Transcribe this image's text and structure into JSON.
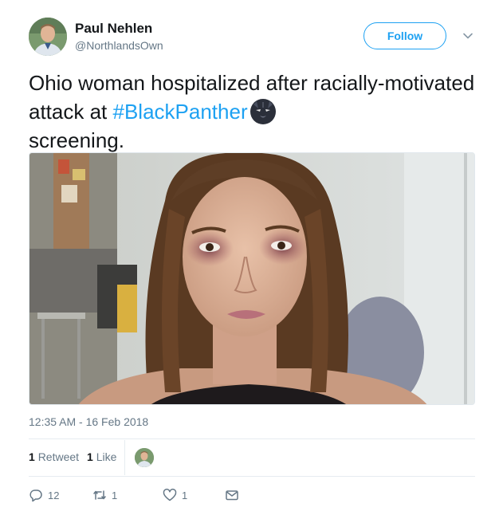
{
  "author": {
    "name": "Paul Nehlen",
    "handle": "@NorthlandsOwn"
  },
  "follow_button": {
    "label": "Follow"
  },
  "tweet": {
    "text_before": "Ohio woman hospitalized after racially-motivated attack at ",
    "hashtag": "#BlackPanther",
    "text_after": "screening.",
    "hashtag_emoji": "black-panther-mask-emoji"
  },
  "timestamp": "12:35 AM - 16 Feb 2018",
  "stats": {
    "retweets_count": "1",
    "retweets_label": "Retweet",
    "likes_count": "1",
    "likes_label": "Like"
  },
  "actions": {
    "reply_count": "12",
    "retweet_count": "1",
    "like_count": "1"
  },
  "colors": {
    "accent": "#1da1f2",
    "text": "#14171a",
    "muted": "#657786",
    "divider": "#e6ecf0"
  },
  "icons": [
    "reply-icon",
    "retweet-icon",
    "like-icon",
    "direct-message-icon",
    "chevron-down-icon"
  ]
}
